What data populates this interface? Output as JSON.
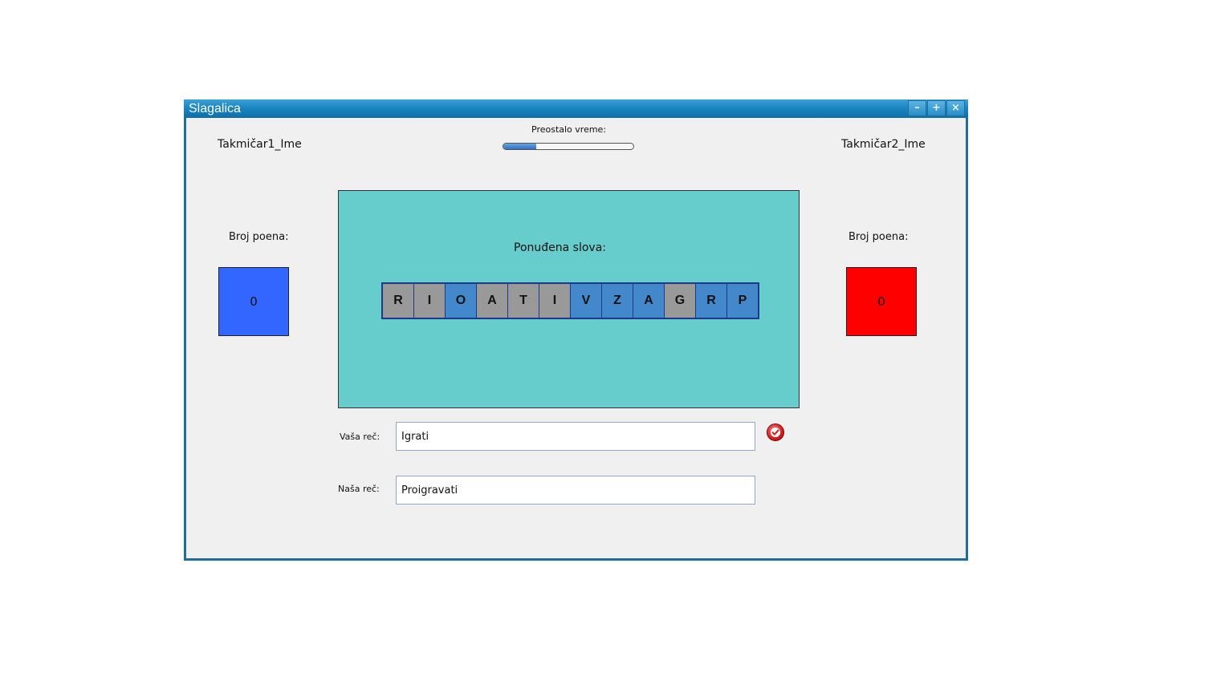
{
  "window": {
    "title": "Slagalica",
    "minimize_glyph": "–",
    "maximize_glyph": "+",
    "close_glyph": "×"
  },
  "timer": {
    "label": "Preostalo vreme:",
    "remaining_fraction": 0.25
  },
  "player1": {
    "name": "Takmičar1_Ime",
    "score_label": "Broj poena:",
    "score": "0",
    "color": "#3366ff"
  },
  "player2": {
    "name": "Takmičar2_Ime",
    "score_label": "Broj poena:",
    "score": "0",
    "color": "#ff0000"
  },
  "letters_panel": {
    "title": "Ponuđena slova:",
    "background": "#66cccc",
    "letters": [
      {
        "letter": "R",
        "state": "gray"
      },
      {
        "letter": "I",
        "state": "gray"
      },
      {
        "letter": "O",
        "state": "blue"
      },
      {
        "letter": "A",
        "state": "gray"
      },
      {
        "letter": "T",
        "state": "gray"
      },
      {
        "letter": "I",
        "state": "gray"
      },
      {
        "letter": "V",
        "state": "blue"
      },
      {
        "letter": "Z",
        "state": "blue"
      },
      {
        "letter": "A",
        "state": "blue"
      },
      {
        "letter": "G",
        "state": "gray"
      },
      {
        "letter": "R",
        "state": "blue"
      },
      {
        "letter": "P",
        "state": "blue"
      }
    ]
  },
  "your_word": {
    "label": "Vaša reč:",
    "value": "Igrati",
    "confirm_icon": "check-icon"
  },
  "our_word": {
    "label": "Naša reč:",
    "value": "Proigravati"
  }
}
